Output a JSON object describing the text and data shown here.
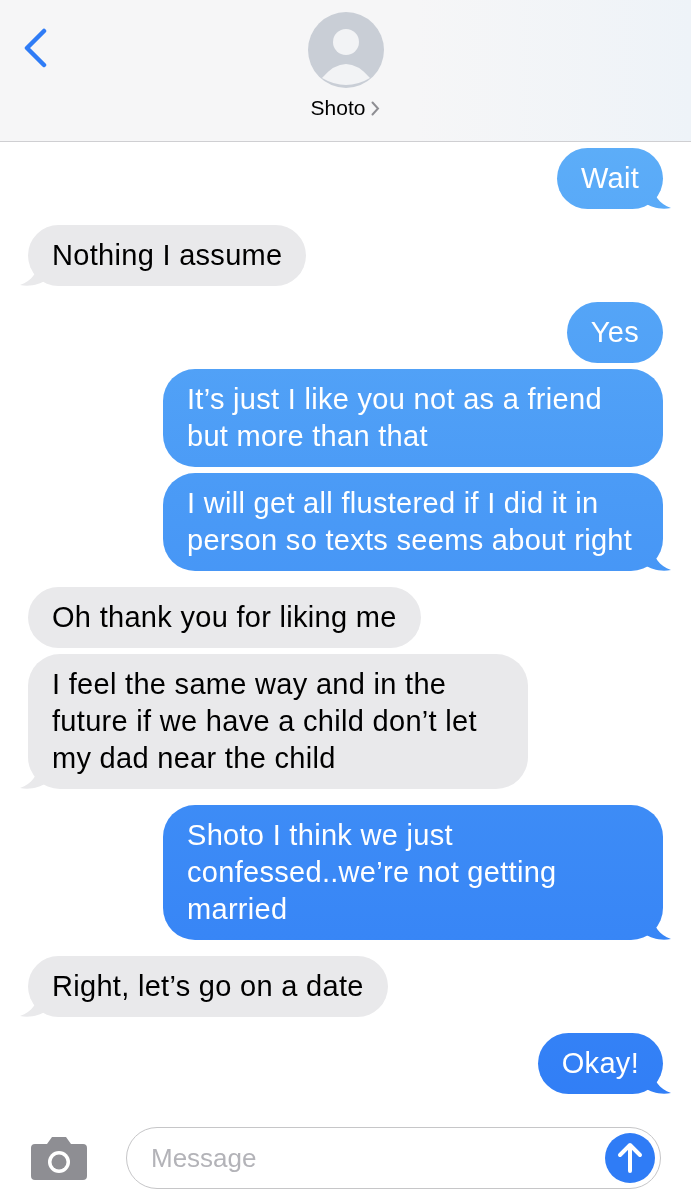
{
  "header": {
    "contact_name": "Shoto"
  },
  "messages": [
    {
      "kind": "sent",
      "text": "Wait"
    },
    {
      "kind": "received",
      "text": "Nothing I assume"
    },
    {
      "kind": "sent",
      "text": "Yes"
    },
    {
      "kind": "sent",
      "text": "It’s just I like you not as a friend but more than that"
    },
    {
      "kind": "sent",
      "text": "I will get all flustered if I did it in person so texts seems about right"
    },
    {
      "kind": "received",
      "text": "Oh thank you for liking me"
    },
    {
      "kind": "received",
      "text": "I feel the same way and in the future if we have a child don’t let my dad near the child"
    },
    {
      "kind": "sent",
      "text": "Shoto I think we just confessed..we’re not getting married"
    },
    {
      "kind": "received",
      "text": "Right, let’s go on a date"
    },
    {
      "kind": "sent",
      "text": "Okay!"
    }
  ],
  "composer": {
    "placeholder": "Message"
  }
}
